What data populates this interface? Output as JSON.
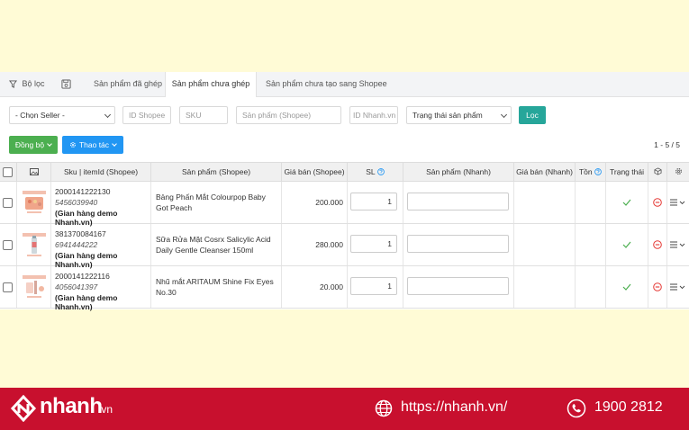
{
  "tabs": {
    "filter_label": "Bộ lọc",
    "matched": "Sản phẩm đã ghép",
    "unmatched": "Sản phẩm chưa ghép",
    "not_created": "Sản phẩm chưa tạo sang Shopee"
  },
  "filters": {
    "seller": "- Chọn Seller -",
    "id_shopee": "ID Shopee",
    "sku": "SKU",
    "product_shopee": "Sản phẩm (Shopee)",
    "id_nhanh": "ID Nhanh.vn",
    "status": "Trạng thái sản phẩm",
    "filter_button": "Lọc"
  },
  "actions": {
    "sync": "Đồng bộ",
    "operations": "Thao tác"
  },
  "pagination": "1 - 5 / 5",
  "columns": {
    "sku": "Sku | itemId (Shopee)",
    "product_shopee": "Sản phẩm (Shopee)",
    "price_shopee": "Giá bán (Shopee)",
    "qty": "SL",
    "product_nhanh": "Sản phẩm (Nhanh)",
    "price_nhanh": "Giá bán (Nhanh)",
    "stock": "Tồn",
    "status": "Trạng thái"
  },
  "rows": [
    {
      "sku": "2000141222130",
      "item_id": "5456039940",
      "shop": "(Gian hàng demo Nhanh.vn)",
      "product": "Bảng Phấn Mắt Colourpop Baby Got Peach",
      "price": "200.000",
      "qty": "1"
    },
    {
      "sku": "381370084167",
      "item_id": "6941444222",
      "shop": "(Gian hàng demo Nhanh.vn)",
      "product": "Sữa Rửa Mặt Cosrx Salicylic Acid Daily Gentle Cleanser 150ml",
      "price": "280.000",
      "qty": "1"
    },
    {
      "sku": "2000141222116",
      "item_id": "4056041397",
      "shop": "(Gian hàng demo Nhanh.vn)",
      "product": "Nhũ mắt ARITAUM Shine Fix Eyes No.30",
      "price": "20.000",
      "qty": "1"
    }
  ],
  "footer": {
    "brand": "nhanh",
    "brand_suffix": ".vn",
    "url": "https://nhanh.vn/",
    "phone": "1900 2812"
  },
  "colors": {
    "primary_green": "#4caf50",
    "primary_blue": "#2196f3",
    "teal": "#26a69a",
    "footer_red": "#c8102e",
    "page_bg": "#fffbd6"
  }
}
